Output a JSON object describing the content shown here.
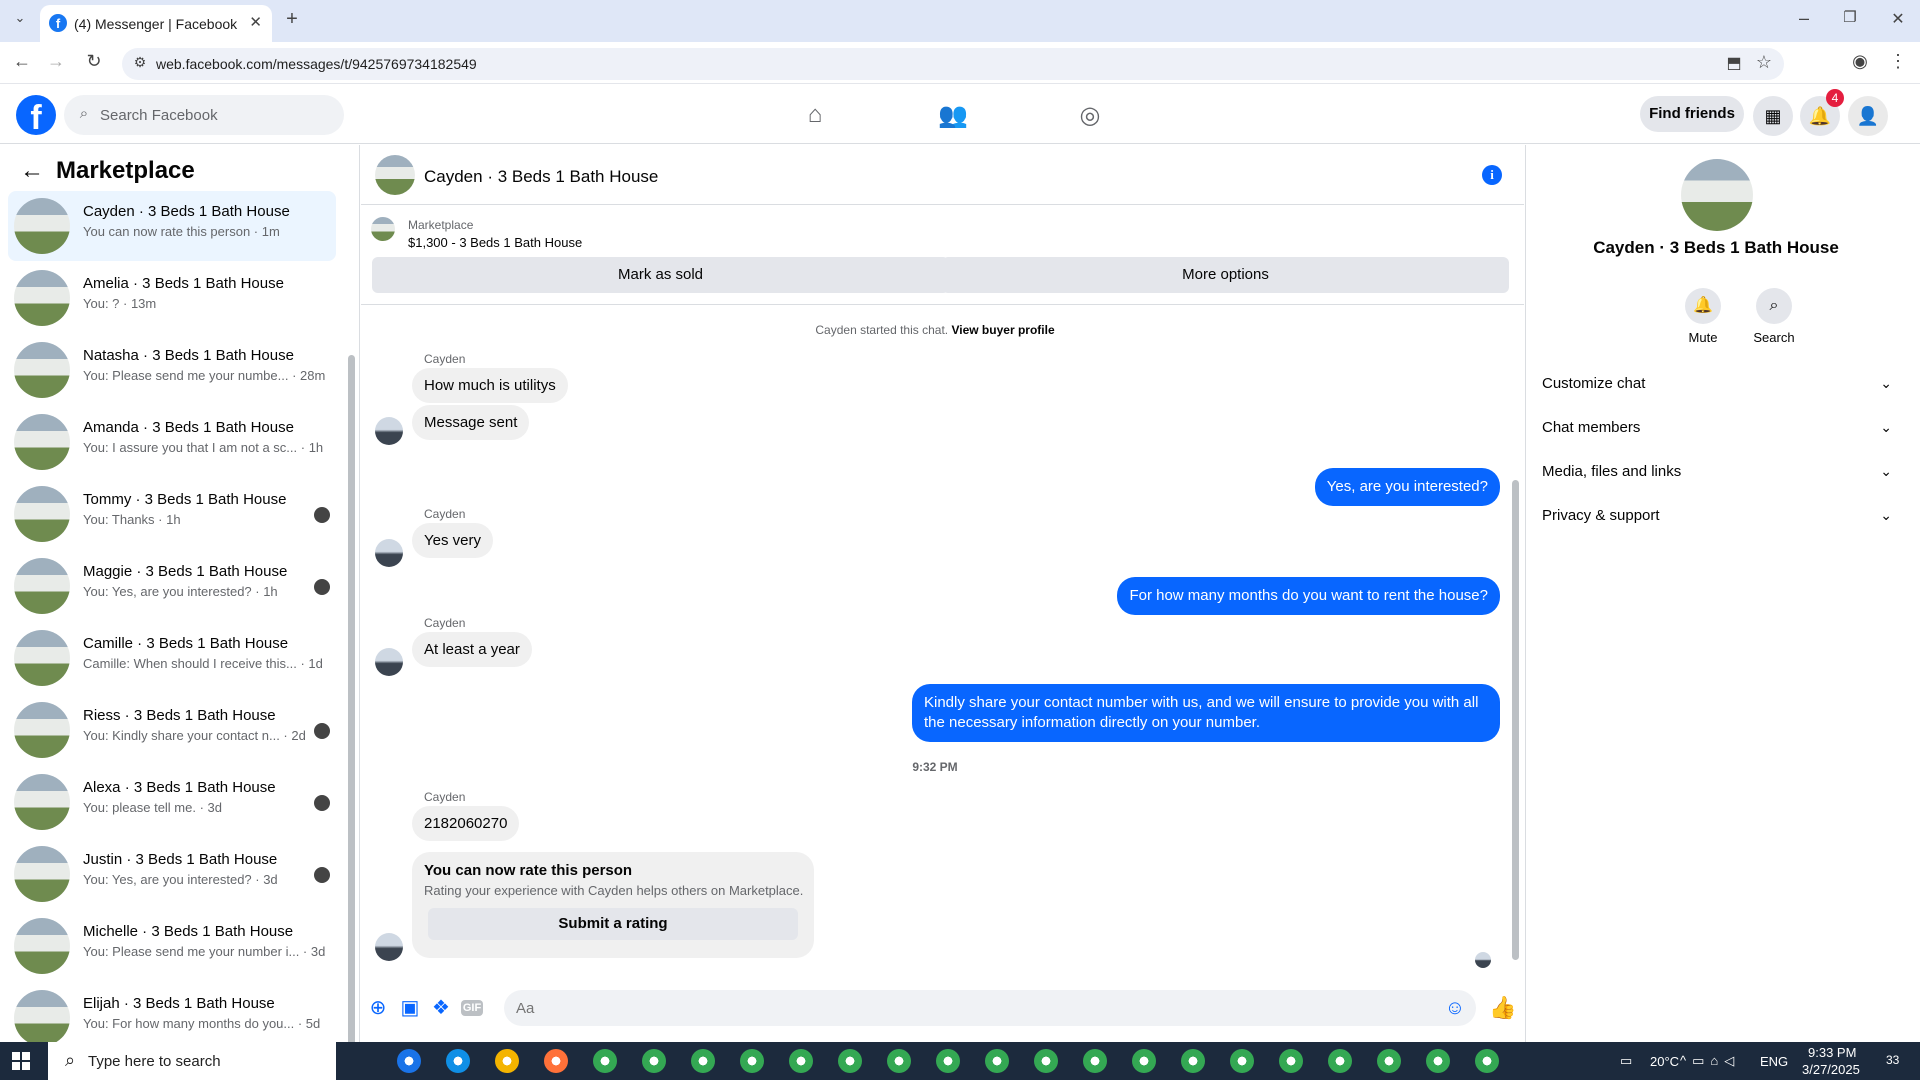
{
  "browser": {
    "tab_title": "(4) Messenger | Facebook",
    "url": "web.facebook.com/messages/t/9425769734182549"
  },
  "fb": {
    "search_placeholder": "Search Facebook",
    "find_friends": "Find friends",
    "notification_count": "4",
    "nav_icons": [
      "home-icon",
      "friends-icon",
      "groups-icon"
    ]
  },
  "sidebar": {
    "title": "Marketplace",
    "conversations": [
      {
        "name": "Cayden · 3 Beds 1 Bath House",
        "preview": "You can now rate this person · 1m",
        "active": true
      },
      {
        "name": "Amelia · 3 Beds 1 Bath House",
        "preview": "You: ? · 13m"
      },
      {
        "name": "Natasha · 3 Beds 1 Bath House",
        "preview": "You: Please send me your numbe... · 28m"
      },
      {
        "name": "Amanda · 3 Beds 1 Bath House",
        "preview": "You: I assure you that I am not a sc... · 1h"
      },
      {
        "name": "Tommy · 3 Beds 1 Bath House",
        "preview": "You: Thanks · 1h"
      },
      {
        "name": "Maggie · 3 Beds 1 Bath House",
        "preview": "You: Yes, are you interested? · 1h"
      },
      {
        "name": "Camille · 3 Beds 1 Bath House",
        "preview": "Camille: When should I receive this... · 1d"
      },
      {
        "name": "Riess · 3 Beds 1 Bath House",
        "preview": "You: Kindly share your contact n... · 2d"
      },
      {
        "name": "Alexa · 3 Beds 1 Bath House",
        "preview": "You: please tell me. · 3d"
      },
      {
        "name": "Justin · 3 Beds 1 Bath House",
        "preview": "You: Yes, are you interested? · 3d"
      },
      {
        "name": "Michelle · 3 Beds 1 Bath House",
        "preview": "You: Please send me your number i... · 3d"
      },
      {
        "name": "Elijah · 3 Beds 1 Bath House",
        "preview": "You: For how many months do you... · 5d"
      }
    ]
  },
  "chat": {
    "title": "Cayden · 3 Beds 1 Bath House",
    "marketplace_label": "Marketplace",
    "listing": "$1,300 - 3 Beds 1 Bath House",
    "mark_sold": "Mark as sold",
    "more_options": "More options",
    "started_text": "Cayden started this chat.",
    "buyer_profile": "View buyer profile",
    "sender_name": "Cayden",
    "msgs": {
      "in1": "How much is utilitys",
      "in2": "Message sent",
      "out1": "Yes, are you interested?",
      "in3": "Yes very",
      "out2": "For how many months do you want to rent the house?",
      "in4": "At least a year",
      "out3": "Kindly share your contact number with us, and we will ensure to provide you with all the necessary information directly on your number.",
      "time": "9:32 PM",
      "in5": "2182060270"
    },
    "rate_title": "You can now rate this person",
    "rate_sub": "Rating your experience with Cayden helps others on Marketplace.",
    "rate_button": "Submit a rating",
    "input_placeholder": "Aa"
  },
  "right_panel": {
    "name": "Cayden · 3 Beds 1 Bath House",
    "mute": "Mute",
    "search": "Search",
    "sections": [
      "Customize chat",
      "Chat members",
      "Media, files and links",
      "Privacy & support"
    ]
  },
  "taskbar": {
    "search_placeholder": "Type here to search",
    "weather": "20°C",
    "lang": "ENG",
    "time": "9:33 PM",
    "date": "3/27/2025",
    "notif": "33"
  },
  "colors": {
    "accent": "#0866ff",
    "bubble_in": "#f0f0f0",
    "taskbar": "#1c2a3d"
  }
}
